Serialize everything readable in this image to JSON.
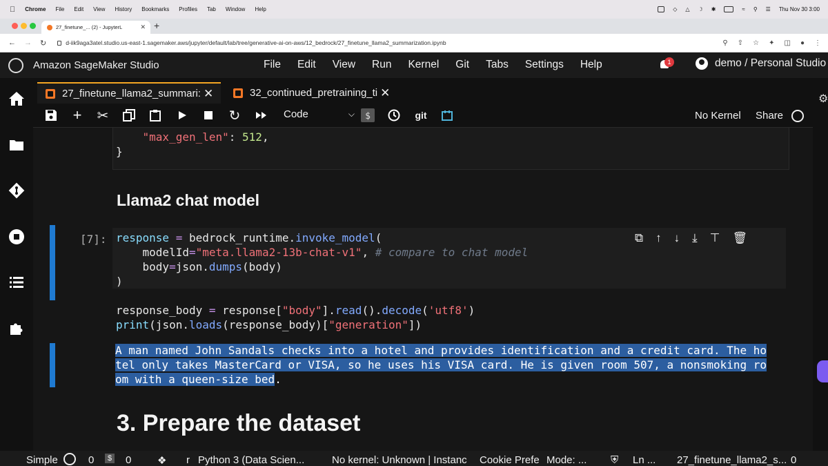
{
  "macos_menubar": {
    "app": "Chrome",
    "items": [
      "File",
      "Edit",
      "View",
      "History",
      "Bookmarks",
      "Profiles",
      "Tab",
      "Window",
      "Help"
    ],
    "datetime": "Thu Nov 30  3:00"
  },
  "browser": {
    "tab_title": "27_finetune_... (2) - JupyterL",
    "url": "d-iik9aga3atel.studio.us-east-1.sagemaker.aws/jupyter/default/lab/tree/generative-ai-on-aws/12_bedrock/27_finetune_llama2_summarization.ipynb"
  },
  "app": {
    "title": "Amazon SageMaker Studio",
    "menu": [
      "File",
      "Edit",
      "View",
      "Run",
      "Kernel",
      "Git",
      "Tabs",
      "Settings",
      "Help"
    ],
    "notifications": "1",
    "user": "demo / Personal Studio"
  },
  "notebook_tabs": [
    {
      "label": "27_finetune_llama2_summari:"
    },
    {
      "label": "32_continued_pretraining_ti"
    }
  ],
  "toolbar": {
    "cell_type": "Code",
    "git_label": "git",
    "kernel_label": "No Kernel",
    "share_label": "Share"
  },
  "cells": {
    "prev_code": {
      "key": "\"max_gen_len\"",
      "colon": ": ",
      "value": "512",
      "comma": ",",
      "close": "}"
    },
    "heading_chat": "Llama2 chat model",
    "code_cell": {
      "prompt": "[7]:",
      "l1_var": "response",
      "l1_eq": " = ",
      "l1_obj": "bedrock_runtime.",
      "l1_fn": "invoke_model",
      "l1_paren": "(",
      "l2_kw": "modelId",
      "l2_eq": "=",
      "l2_str": "\"meta.llama2-13b-chat-v1\"",
      "l2_comma": ", ",
      "l2_comment": "# compare to chat model",
      "l3_kw": "body",
      "l3_eq": "=",
      "l3_obj": "json.",
      "l3_fn": "dumps",
      "l3_rest": "(body)",
      "l4": ")",
      "l6_var": "response_body",
      "l6_eq": " = ",
      "l6_a": "response[",
      "l6_str": "\"body\"",
      "l6_b": "].",
      "l6_fn1": "read",
      "l6_c": "().",
      "l6_fn2": "decode",
      "l6_d": "(",
      "l6_str2": "'utf8'",
      "l6_e": ")",
      "l7_fn": "print",
      "l7_a": "(json.",
      "l7_fn2": "loads",
      "l7_b": "(response_body)[",
      "l7_str": "\"generation\"",
      "l7_c": "])"
    },
    "output_lines": [
      "A man named John Sandals checks into a hotel and provides identification and a credit card. The ho",
      "tel only takes MasterCard or VISA, so he uses his VISA card. He is given room 507, a nonsmoking ro",
      "om with a queen-size bed"
    ],
    "output_tail": ".",
    "heading_dataset": "3. Prepare the dataset"
  },
  "statusbar": {
    "mode": "Simple",
    "count1": "0",
    "count2": "0",
    "r": "r",
    "kernel": "Python 3 (Data Scien...",
    "kernel_status": "No kernel: Unknown | Instanc",
    "cookie": "Cookie Prefe",
    "edit_mode": "Mode: ...",
    "ln": "Ln ...",
    "file": "27_finetune_llama2_s...",
    "count3": "0"
  },
  "colors": {
    "accent_tab": "#f5a623",
    "cell_selected": "#1f7ad1",
    "selection": "#2c5ea0",
    "notification": "#e0393e"
  }
}
